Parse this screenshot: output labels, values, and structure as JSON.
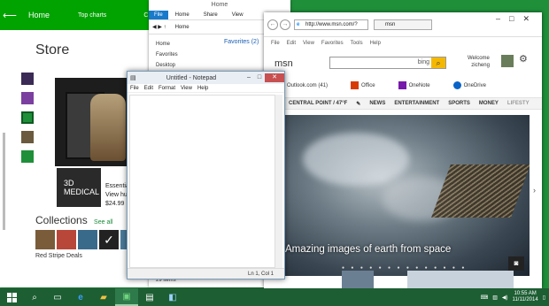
{
  "store": {
    "back": "⟵",
    "home": "Home",
    "top_charts": "Top charts",
    "cut_label": "C",
    "heading": "Store",
    "app_icon_text": "3D MEDICAL",
    "app_name": "Essential",
    "app_sub": "View hu",
    "app_price": "$24.99",
    "collections": "Collections",
    "see_all": "See all",
    "deals": "Red Stripe Deals"
  },
  "explorer": {
    "title": "Home",
    "ribbon": [
      "File",
      "Home",
      "Share",
      "View"
    ],
    "address": "Home",
    "nav": [
      "Home",
      "Favorites",
      "Desktop"
    ],
    "favorites_header": "Favorites (2)",
    "status": "29 items"
  },
  "ie": {
    "url": "http://www.msn.com/?",
    "tab": "msn",
    "menu": [
      "File",
      "Edit",
      "View",
      "Favorites",
      "Tools",
      "Help"
    ],
    "msn_logo": "msn",
    "bing": "bing",
    "welcome": "Welcome",
    "user": "zicheng",
    "apps": [
      "Outlook.com (41)",
      "Office",
      "OneNote",
      "OneDrive"
    ],
    "nav": [
      "CENTRAL POINT / 47°F",
      "NEWS",
      "ENTERTAINMENT",
      "SPORTS",
      "MONEY",
      "LIFESTY"
    ],
    "caption": "Amazing images of earth from space"
  },
  "notepad": {
    "title": "Untitled - Notepad",
    "menu": [
      "File",
      "Edit",
      "Format",
      "View",
      "Help"
    ],
    "status": "Ln 1, Col 1"
  },
  "taskbar": {
    "time": "10:55 AM",
    "date": "11/11/2014"
  },
  "colors": {
    "desktop": "#1f8f3a",
    "store_accent": "#00a300",
    "taskbar": "#1d5e33",
    "notepad_close": "#c75050",
    "bing_go": "#f5b800"
  }
}
